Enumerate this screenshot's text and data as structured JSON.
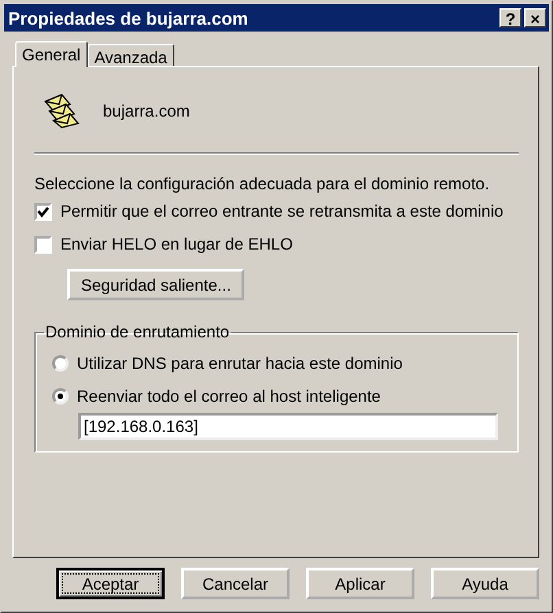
{
  "window": {
    "title": "Propiedades de bujarra.com",
    "help_button": "?",
    "close_button": "×"
  },
  "tabs": [
    {
      "label": "General",
      "selected": true
    },
    {
      "label": "Avanzada",
      "selected": false
    }
  ],
  "domain": "bujarra.com",
  "instruction": "Seleccione la configuración adecuada para el dominio remoto.",
  "checkboxes": [
    {
      "label": "Permitir que el correo entrante se retransmita a este dominio",
      "checked": true
    },
    {
      "label": "Enviar HELO en lugar de EHLO",
      "checked": false
    }
  ],
  "security_button": "Seguridad saliente...",
  "routing": {
    "title": "Dominio de enrutamiento",
    "options": [
      {
        "label": "Utilizar DNS para enrutar hacia este dominio",
        "selected": false
      },
      {
        "label": "Reenviar todo el correo al host inteligente",
        "selected": true
      }
    ],
    "host": "[192.168.0.163]"
  },
  "buttons": [
    {
      "label": "Aceptar",
      "default": true
    },
    {
      "label": "Cancelar",
      "default": false
    },
    {
      "label": "Aplicar",
      "default": false
    },
    {
      "label": "Ayuda",
      "default": false
    }
  ]
}
